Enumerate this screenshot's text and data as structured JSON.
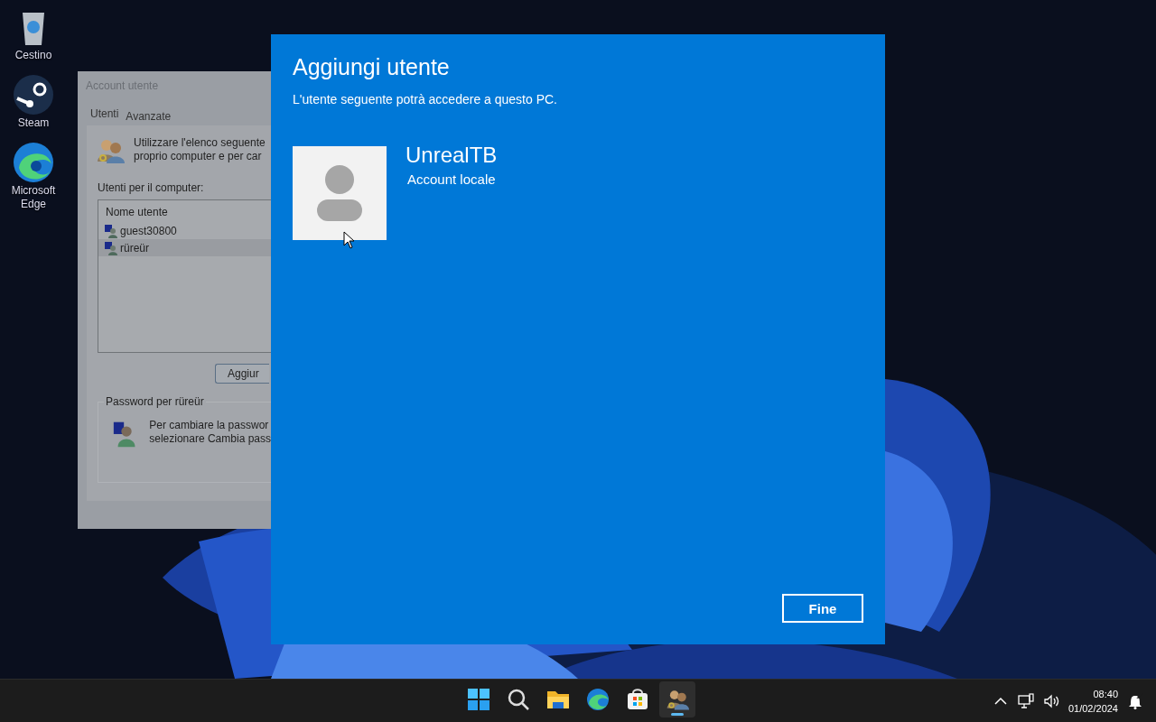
{
  "desktop_icons": [
    {
      "label": "Cestino",
      "kind": "bin"
    },
    {
      "label": "Steam",
      "kind": "steam"
    },
    {
      "label": "Microsoft Edge",
      "kind": "edge"
    }
  ],
  "background_window": {
    "title": "Account utente",
    "tabs": [
      {
        "label": "Utenti",
        "selected": true
      },
      {
        "label": "Avanzate",
        "selected": false
      }
    ],
    "intro": [
      "Utilizzare l'elenco seguente",
      "proprio computer e per car"
    ],
    "list_label": "Utenti per il computer:",
    "list_header": "Nome utente",
    "users": [
      {
        "name": "guest30800",
        "selected": false
      },
      {
        "name": "rüreür",
        "selected": true
      }
    ],
    "add_button": "Aggiur",
    "password_group": {
      "title": "Password per rüreür",
      "text": [
        "Per cambiare la passwor",
        "selezionare Cambia pass"
      ]
    }
  },
  "dialog": {
    "title": "Aggiungi utente",
    "subtitle": "L'utente seguente potrà accedere a questo PC.",
    "user_name": "UnrealTB",
    "account_type": "Account locale",
    "button": "Fine"
  },
  "taskbar": {
    "apps": [
      {
        "kind": "start",
        "selected": false
      },
      {
        "kind": "search",
        "selected": false
      },
      {
        "kind": "explorer",
        "selected": false
      },
      {
        "kind": "edge",
        "selected": false
      },
      {
        "kind": "store",
        "selected": false
      },
      {
        "kind": "users",
        "selected": true
      }
    ],
    "time": "08:40",
    "date": "01/02/2024"
  }
}
